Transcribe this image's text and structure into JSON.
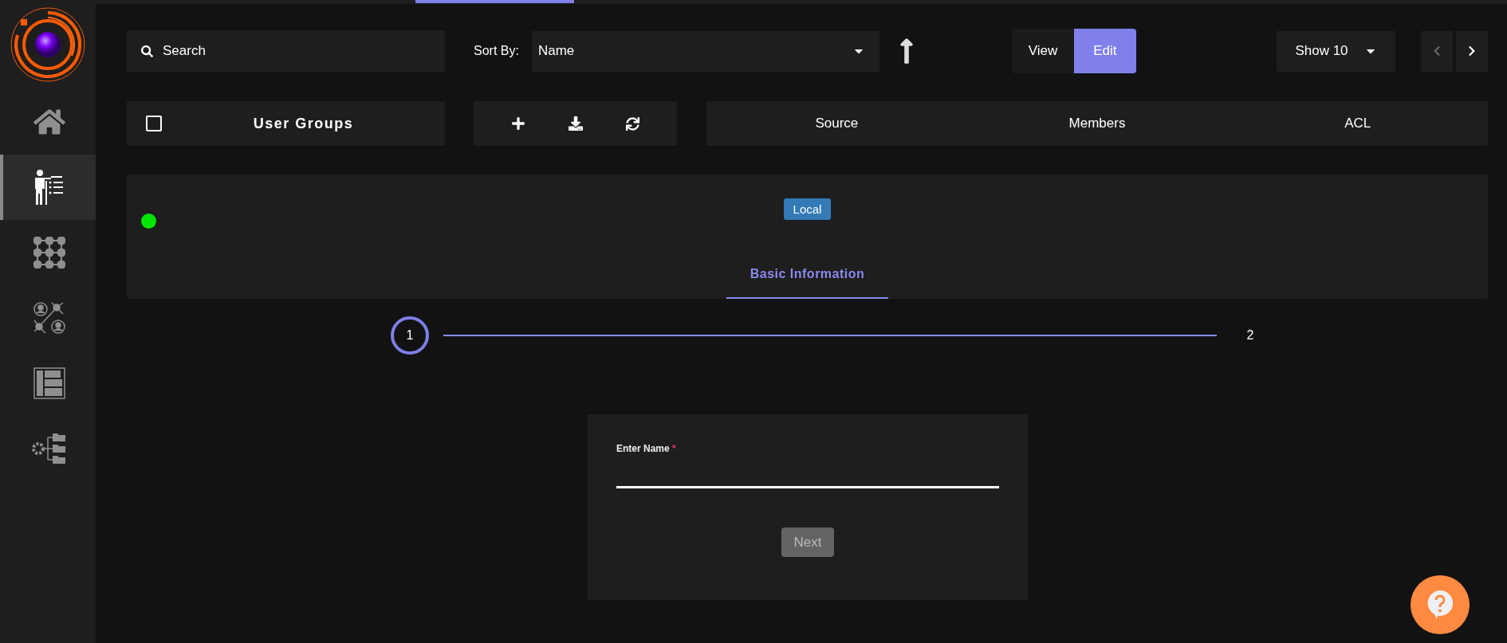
{
  "sidebar": {
    "items": [
      {
        "selected": false
      },
      {
        "selected": true
      },
      {
        "selected": false
      },
      {
        "selected": false
      },
      {
        "selected": false
      },
      {
        "selected": false
      }
    ]
  },
  "toolbar": {
    "search": {
      "placeholder": "Search"
    },
    "sort": {
      "label": "Sort By:",
      "value": "Name"
    },
    "mode": [
      {
        "label": "View",
        "selected": false
      },
      {
        "label": "Edit",
        "selected": true
      }
    ],
    "page_size": "Show 10",
    "prev_disabled": true,
    "next_disabled": false
  },
  "header": {
    "checked": false,
    "title": "User Groups",
    "columns": [
      "Source",
      "Members",
      "ACL"
    ]
  },
  "record": {
    "color": "#00e600",
    "source": "Local"
  },
  "tabs": [
    {
      "label": "Basic Information",
      "selected": true
    }
  ],
  "steps": [
    {
      "label": "1",
      "selected": true
    },
    {
      "label": "2",
      "selected": false
    }
  ],
  "form": {
    "label": "Enter Name",
    "required": true,
    "required_mark": "*",
    "button": "Next",
    "button_disabled": true
  }
}
